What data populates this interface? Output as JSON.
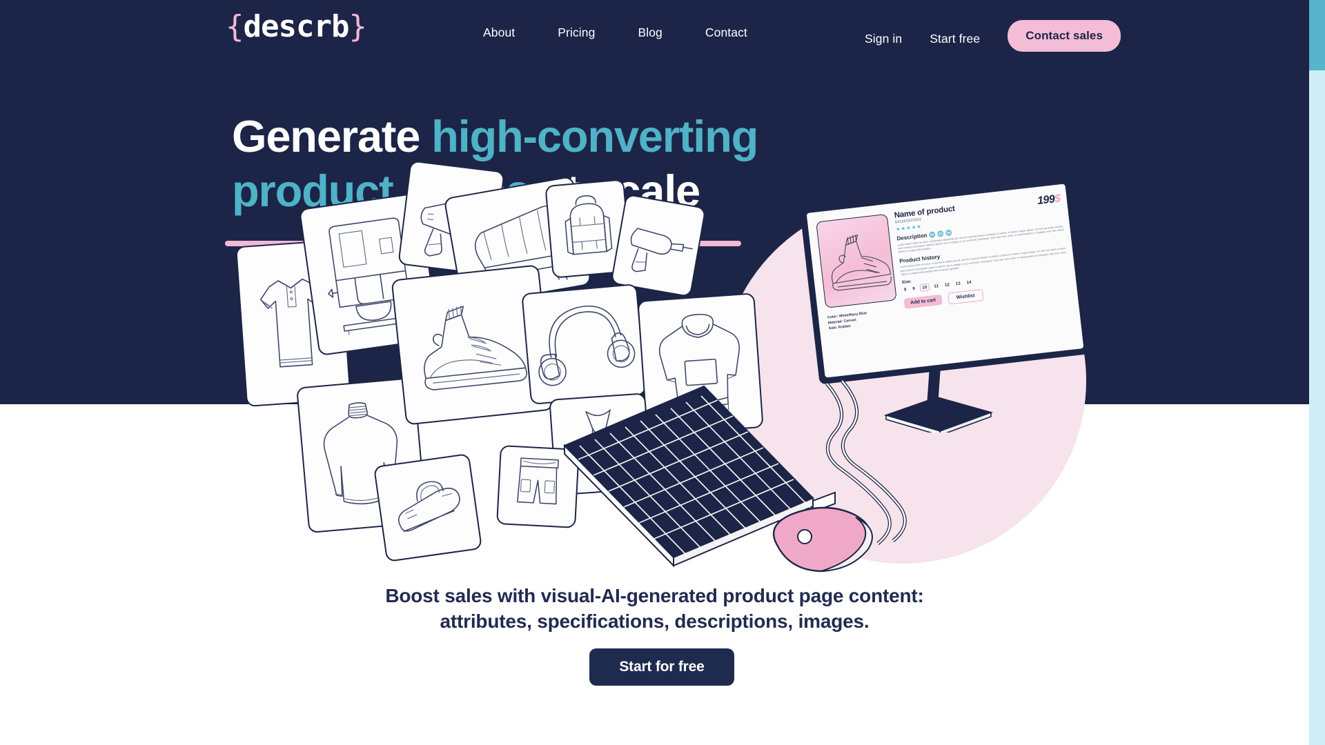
{
  "brand": {
    "name": "descrb",
    "open_brace": "{",
    "close_brace": "}"
  },
  "colors": {
    "navy": "#1c2547",
    "teal": "#4fb2c6",
    "pink": "#f3bcd7",
    "pink_soft": "#f7e3eb",
    "white": "#ffffff",
    "scrollbar_track": "#cfeef7",
    "scrollbar_thumb": "#57b4cb"
  },
  "nav": {
    "links": [
      {
        "label": "About"
      },
      {
        "label": "Pricing"
      },
      {
        "label": "Blog"
      },
      {
        "label": "Contact"
      }
    ],
    "sign_in": "Sign in",
    "start_free": "Start free",
    "contact_sales": "Contact sales"
  },
  "hero": {
    "line1_plain": "Generate ",
    "line1_accent": "high-converting",
    "line2_accent": "product pages",
    "line2_plain": " at scale",
    "subcopy_line1": "Boost sales with visual-AI-generated product page content:",
    "subcopy_line2": "attributes, specifications, descriptions, images.",
    "cta": "Start for free"
  },
  "product_mockup": {
    "name": "Name of product",
    "sku": "641343315631",
    "price_value": "199",
    "price_currency": "$",
    "stars": "★★★★★",
    "description_heading": "Description",
    "languages": [
      "FR",
      "ES",
      "DE"
    ],
    "description_body": "Lorem ipsum dolor sit amet, consectetur adipiscing elit, sed do eiusmod tempor incididunt ut labore et dolore magna aliqua. Ut enim ad minim veniam, quis nostrud exercitation ullamco laboris nisi ut aliquip ex ea commodo consequat. Duis aute irure dolor in reprehenderit in voluptate velit esse cillum dolore eu fugiat nulla pariatur.",
    "history_heading": "Product history",
    "history_body": "Lorem ipsum dolor sit amet, consectetur adipiscing elit, sed do eiusmod tempor incididunt ut labore et dolore magna aliqua. Ut enim ad minim veniam, quis nostrud exercitation ullamco laboris nisi ut aliquip ex ea commodo consequat. Duis aute irure dolor in reprehenderit in voluptate velit esse cillum dolore eu fugiat nulla pariatur sint occaecat cupidatat.",
    "specs": {
      "color": "Color: White/Navy Blue",
      "material": "Material: Canvas",
      "sole": "Sole: Rubber"
    },
    "size_label": "Size:",
    "sizes": [
      "8",
      "9",
      "10",
      "11",
      "12",
      "13",
      "14"
    ],
    "selected_size": "10",
    "add_to_cart": "Add to cart",
    "wishlist": "Wishlist"
  },
  "collage": {
    "items": [
      {
        "name": "polo-shirt"
      },
      {
        "name": "coffee-machine"
      },
      {
        "name": "hair-dryer"
      },
      {
        "name": "sofa"
      },
      {
        "name": "backpack"
      },
      {
        "name": "drill"
      },
      {
        "name": "sweater"
      },
      {
        "name": "sneaker"
      },
      {
        "name": "headphones"
      },
      {
        "name": "hoodie"
      },
      {
        "name": "dress"
      },
      {
        "name": "shorts"
      },
      {
        "name": "iron"
      }
    ]
  }
}
